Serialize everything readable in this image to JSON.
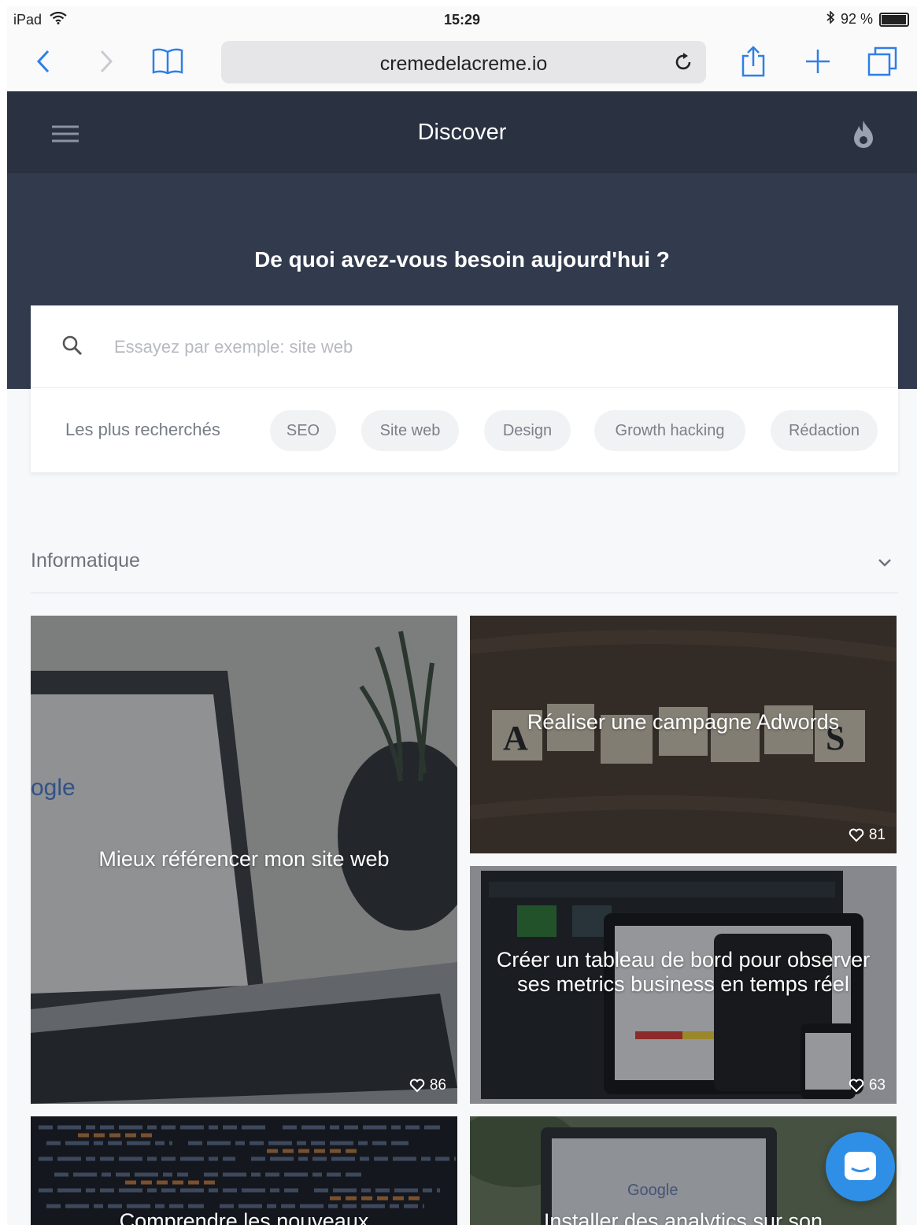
{
  "status_bar": {
    "device": "iPad",
    "time": "15:29",
    "battery": "92 %",
    "battery_level": 0.92
  },
  "browser": {
    "url": "cremedelacreme.io"
  },
  "app_header": {
    "title": "Discover"
  },
  "hero": {
    "heading": "De quoi avez-vous besoin aujourd'hui ?",
    "search_placeholder": "Essayez par exemple: site web"
  },
  "popular": {
    "label": "Les plus recherchés",
    "chips": [
      "SEO",
      "Site web",
      "Design",
      "Growth hacking",
      "Rédaction"
    ]
  },
  "section": {
    "title": "Informatique"
  },
  "cards": [
    {
      "title": "Mieux référencer mon site web",
      "likes": "86"
    },
    {
      "title": "Réaliser une campagne Adwords",
      "likes": "81"
    },
    {
      "title": "Créer un tableau de bord pour observer ses metrics business en temps réel",
      "likes": "63"
    },
    {
      "title": "Comprendre les nouveaux",
      "likes": ""
    },
    {
      "title": "Installer des analytics sur son",
      "likes": ""
    }
  ],
  "icons": {
    "wifi": "wifi-icon",
    "bluetooth": "bluetooth-icon",
    "battery": "battery-icon",
    "back": "chevron-left-icon",
    "forward": "chevron-right-icon",
    "bookmarks": "book-icon",
    "reload": "reload-icon",
    "share": "share-icon",
    "new_tab": "plus-icon",
    "tabs": "tabs-icon",
    "menu": "hamburger-icon",
    "flame": "flame-icon",
    "search": "search-icon",
    "chevron": "chevron-down-icon",
    "heart": "heart-icon",
    "chat": "chat-icon"
  },
  "colors": {
    "header": "#2a3141",
    "hero": "#323b4d",
    "accent": "#2f7fe6",
    "chat_button": "#2f8fe6"
  }
}
